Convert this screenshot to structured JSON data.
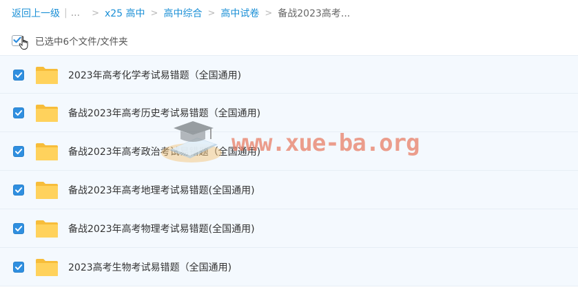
{
  "breadcrumb": {
    "back_label": "返回上一级",
    "separator": "|",
    "ellipsis": "...",
    "items": [
      {
        "label": "x25 高中"
      },
      {
        "label": "高中综合"
      },
      {
        "label": "高中试卷"
      }
    ],
    "current": "备战2023高考..."
  },
  "selection": {
    "label": "已选中6个文件/文件夹"
  },
  "files": [
    {
      "name": "2023年高考化学考试易错题（全国通用)",
      "checked": true
    },
    {
      "name": "备战2023年高考历史考试易错题（全国通用)",
      "checked": true
    },
    {
      "name": "备战2023年高考政治考试易错题（全国通用)",
      "checked": true
    },
    {
      "name": "备战2023年高考地理考试易错题(全国通用)",
      "checked": true
    },
    {
      "name": "备战2023年高考物理考试易错题(全国通用)",
      "checked": true
    },
    {
      "name": "2023高考生物考试易错题（全国通用)",
      "checked": true
    }
  ],
  "watermark": {
    "text": "www.xue-ba.org",
    "icon": "graduation-cap-book-icon"
  },
  "colors": {
    "link": "#1a8fd6",
    "checkbox": "#2f8fe0",
    "folder": "#ffc94d",
    "row_background": "#f4f9fe"
  }
}
